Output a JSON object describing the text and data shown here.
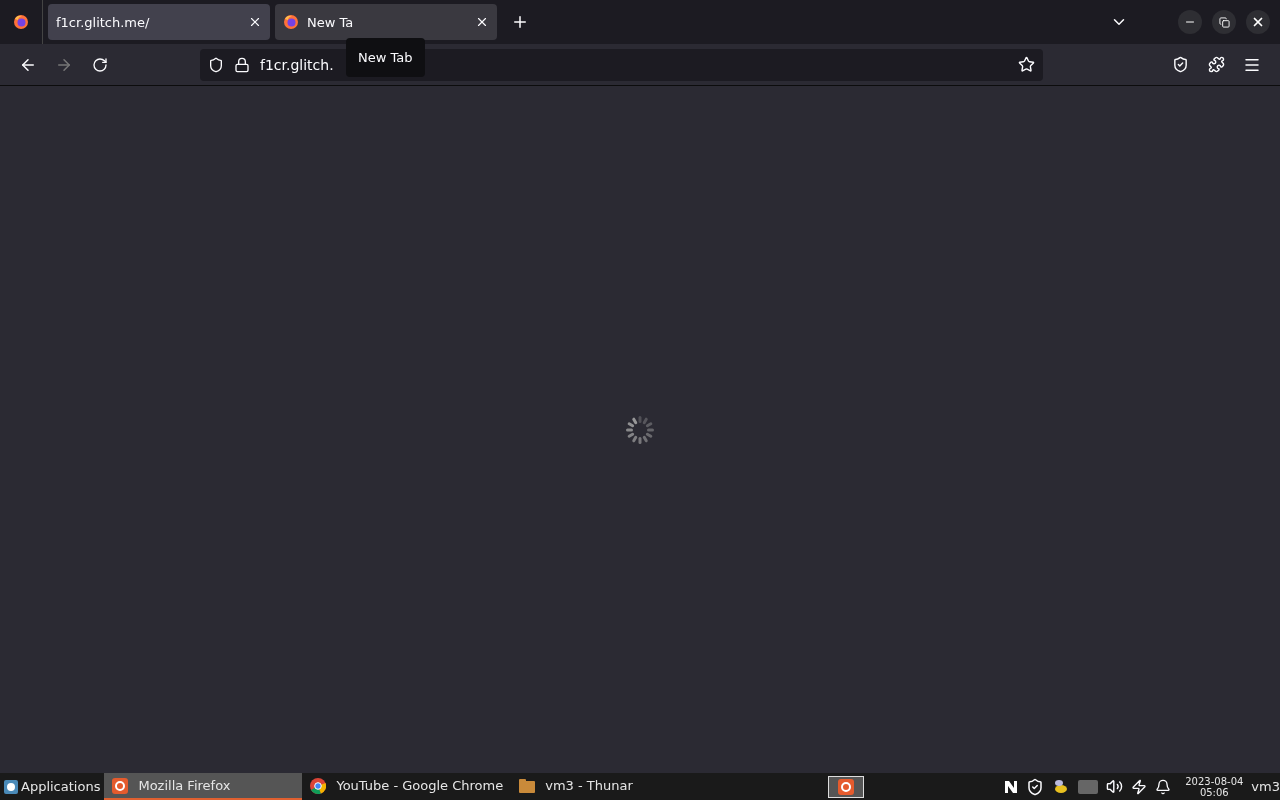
{
  "tabs": [
    {
      "title": "f1cr.glitch.me/",
      "selected": false,
      "icon": false
    },
    {
      "title": "New Ta",
      "selected": true,
      "icon": true
    }
  ],
  "tooltip": "New Tab",
  "url": "f1cr.glitch.",
  "loading": true,
  "taskbar": {
    "menu": "Applications",
    "tasks": [
      {
        "label": "Mozilla Firefox",
        "selected": true,
        "kind": "firefox"
      },
      {
        "label": "YouTube - Google Chrome",
        "selected": false,
        "kind": "chrome"
      },
      {
        "label": "vm3 - Thunar",
        "selected": false,
        "kind": "folder"
      }
    ],
    "date": "2023-08-04",
    "time": "05:06",
    "host": "vm3"
  }
}
